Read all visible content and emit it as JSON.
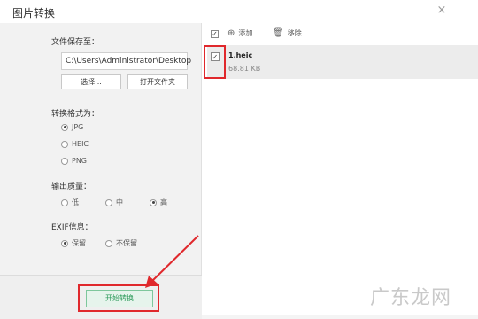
{
  "window": {
    "title": "图片转换",
    "close_glyph": "×"
  },
  "save": {
    "label": "文件保存至：",
    "path": "C:\\Users\\Administrator\\Desktop",
    "choose_button": "选择...",
    "open_folder_button": "打开文件夹"
  },
  "format": {
    "label": "转换格式为：",
    "options": [
      "JPG",
      "HEIC",
      "PNG"
    ],
    "selected": "JPG"
  },
  "quality": {
    "label": "输出质量：",
    "options": [
      "低",
      "中",
      "高"
    ],
    "selected": "高"
  },
  "exif": {
    "label": "EXIF信息：",
    "options": [
      "保留",
      "不保留"
    ],
    "selected": "保留"
  },
  "start_button": "开始转换",
  "toolbar": {
    "add_label": "添加",
    "remove_label": "移除",
    "add_icon": "plus-circle-icon",
    "remove_icon": "trash-icon"
  },
  "files": [
    {
      "name": "1.heic",
      "size": "68.81 KB",
      "checked": true
    }
  ],
  "watermark": "广东龙网",
  "highlight_color": "#e0282c",
  "accent_color": "#2c9a5a"
}
